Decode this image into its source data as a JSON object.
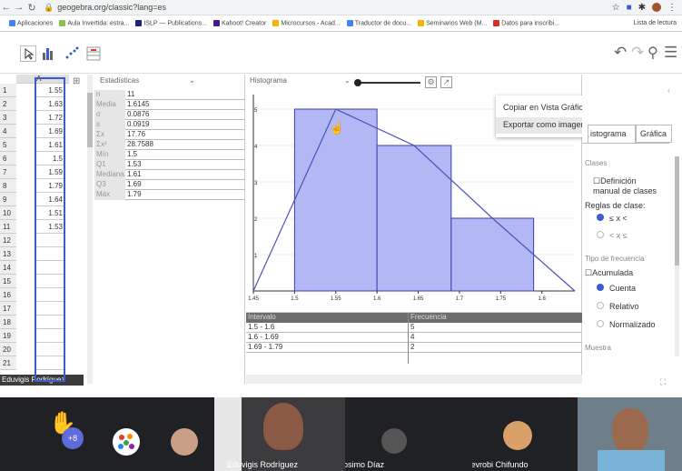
{
  "browser": {
    "url": "geogebra.org/classic?lang=es",
    "bookmarks": [
      "Aplicaciones",
      "Aula Invertida: estra...",
      "ISLP — Publications...",
      "Kahoot! Creator",
      "Microcursos - Acad...",
      "Traductor de docu...",
      "Seminarios Web (M...",
      "Datos para inscribi...",
      "Lista de lectura"
    ]
  },
  "spreadsheet": {
    "column_header": "A",
    "rows": [
      {
        "n": "1",
        "v": "1.55"
      },
      {
        "n": "2",
        "v": "1.63"
      },
      {
        "n": "3",
        "v": "1.72"
      },
      {
        "n": "4",
        "v": "1.69"
      },
      {
        "n": "5",
        "v": "1.61"
      },
      {
        "n": "6",
        "v": "1.5"
      },
      {
        "n": "7",
        "v": "1.59"
      },
      {
        "n": "8",
        "v": "1.79"
      },
      {
        "n": "9",
        "v": "1.64"
      },
      {
        "n": "10",
        "v": "1.51"
      },
      {
        "n": "11",
        "v": "1.53"
      },
      {
        "n": "12",
        "v": ""
      },
      {
        "n": "13",
        "v": ""
      },
      {
        "n": "14",
        "v": ""
      },
      {
        "n": "15",
        "v": ""
      },
      {
        "n": "16",
        "v": ""
      },
      {
        "n": "17",
        "v": ""
      },
      {
        "n": "18",
        "v": ""
      },
      {
        "n": "19",
        "v": ""
      },
      {
        "n": "20",
        "v": ""
      },
      {
        "n": "21",
        "v": ""
      }
    ],
    "user_label": "Eduvigis Rodríguez"
  },
  "stats": {
    "dropdown": "Estadísticas",
    "rows": [
      {
        "k": "n",
        "v": "11"
      },
      {
        "k": "Media",
        "v": "1.6145"
      },
      {
        "k": "σ",
        "v": "0.0876"
      },
      {
        "k": "s",
        "v": "0.0919"
      },
      {
        "k": "Σx",
        "v": "17.76"
      },
      {
        "k": "Σx²",
        "v": "28.7588"
      },
      {
        "k": "Mín",
        "v": "1.5"
      },
      {
        "k": "Q1",
        "v": "1.53"
      },
      {
        "k": "Mediana",
        "v": "1.61"
      },
      {
        "k": "Q3",
        "v": "1.69"
      },
      {
        "k": "Máx",
        "v": "1.79"
      }
    ]
  },
  "histogram": {
    "dropdown": "Histograma",
    "table_headers": [
      "Intervalo",
      "Frecuencia"
    ],
    "table_rows": [
      {
        "interval": "1.5 - 1.6",
        "freq": "5"
      },
      {
        "interval": "1.6 - 1.69",
        "freq": "4"
      },
      {
        "interval": "1.69 - 1.79",
        "freq": "2"
      }
    ]
  },
  "chart_data": {
    "type": "bar",
    "bins": [
      [
        1.5,
        1.6
      ],
      [
        1.6,
        1.69
      ],
      [
        1.69,
        1.79
      ]
    ],
    "values": [
      5,
      4,
      2
    ],
    "polygon_x": [
      1.45,
      1.55,
      1.645,
      1.74,
      1.84
    ],
    "polygon_y": [
      0,
      5,
      4,
      2,
      0
    ],
    "x_ticks": [
      "1.45",
      "1.5",
      "1.55",
      "1.6",
      "1.65",
      "1.7",
      "1.75",
      "1.8"
    ],
    "y_ticks": [
      "1",
      "2",
      "3",
      "4",
      "5"
    ],
    "xlim": [
      1.45,
      1.84
    ],
    "ylim": [
      0,
      5.4
    ]
  },
  "context_menu": {
    "items": [
      "Copiar en Vista Gráfica",
      "Exportar como imagen"
    ]
  },
  "right_panel": {
    "tabs": [
      "istograma",
      "Gráfica"
    ],
    "clases_title": "Clases",
    "def_manual": "Definición manual de clases",
    "reglas": "Reglas de clase:",
    "regla_opts": [
      "≤ x <",
      "< x ≤"
    ],
    "tipo_freq": "Tipo de frecuencia",
    "acumulada": "Acumulada",
    "freq_opts": [
      "Cuenta",
      "Relativo",
      "Normalizado"
    ],
    "muestra": "Muestra"
  },
  "video": {
    "raised_count": "+8",
    "participants": [
      "Eduvigis Rodríguez",
      "Sosimo Díaz",
      "Nevrobi Chifundo"
    ]
  },
  "colors": {
    "accent": "#3b5bd0",
    "bar_fill": "#b3b8f5",
    "bar_stroke": "#3a3fa8"
  }
}
